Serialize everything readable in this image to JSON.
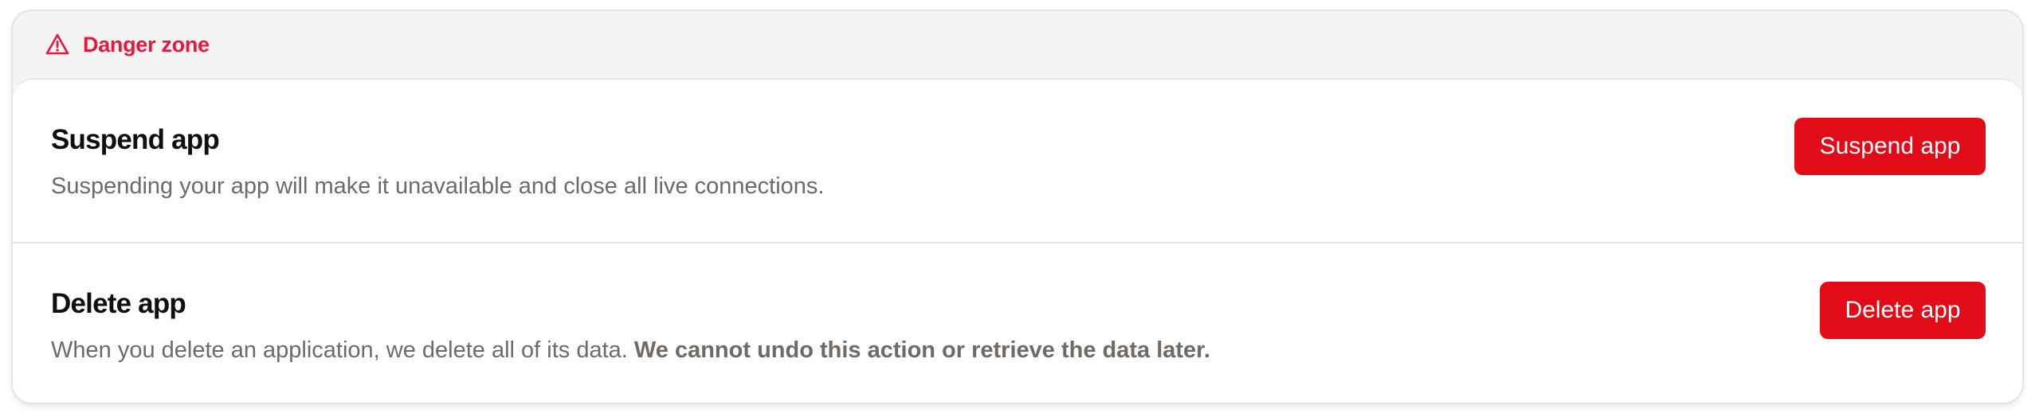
{
  "section": {
    "title": "Danger zone",
    "icon": "warning-triangle-icon",
    "accent_color": "#e8173d"
  },
  "suspend": {
    "title": "Suspend app",
    "description": "Suspending your app will make it unavailable and close all live connections.",
    "button_label": "Suspend app"
  },
  "delete": {
    "title": "Delete app",
    "description_plain": "When you delete an application, we delete all of its data. ",
    "description_bold": "We cannot undo this action or retrieve the data later.",
    "button_label": "Delete app"
  },
  "colors": {
    "button_bg": "#e20c18",
    "button_text": "#ffffff",
    "text_primary": "#0f0f0f",
    "text_secondary": "#6f6a66",
    "panel_bg": "#f4f4f4"
  }
}
